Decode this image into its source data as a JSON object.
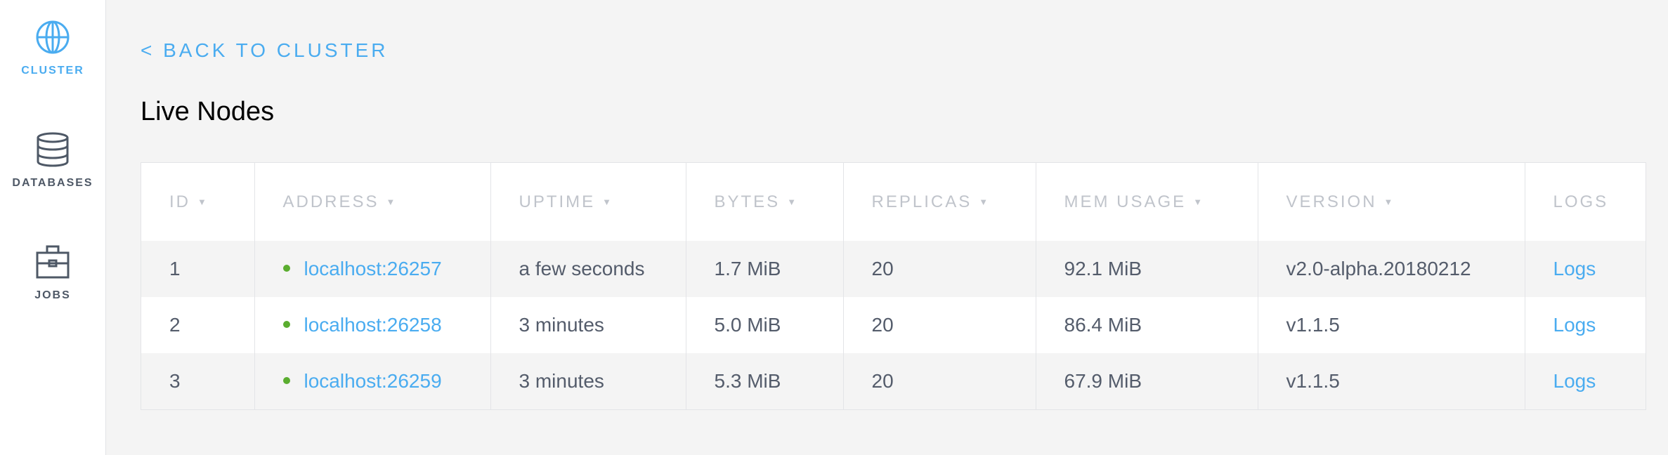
{
  "sidebar": {
    "items": [
      {
        "label": "CLUSTER",
        "icon": "globe-icon",
        "active": true
      },
      {
        "label": "DATABASES",
        "icon": "database-icon",
        "active": false
      },
      {
        "label": "JOBS",
        "icon": "briefcase-icon",
        "active": false
      }
    ]
  },
  "back_link": "< BACK TO CLUSTER",
  "page_title": "Live Nodes",
  "table": {
    "columns": [
      "ID",
      "ADDRESS",
      "UPTIME",
      "BYTES",
      "REPLICAS",
      "MEM USAGE",
      "VERSION",
      "LOGS"
    ],
    "sort_indicator": "▼",
    "rows": [
      {
        "id": "1",
        "address": "localhost:26257",
        "uptime": "a few seconds",
        "bytes": "1.7 MiB",
        "replicas": "20",
        "mem_usage": "92.1 MiB",
        "version": "v2.0-alpha.20180212",
        "logs": "Logs"
      },
      {
        "id": "2",
        "address": "localhost:26258",
        "uptime": "3 minutes",
        "bytes": "5.0 MiB",
        "replicas": "20",
        "mem_usage": "86.4 MiB",
        "version": "v1.1.5",
        "logs": "Logs"
      },
      {
        "id": "3",
        "address": "localhost:26259",
        "uptime": "3 minutes",
        "bytes": "5.3 MiB",
        "replicas": "20",
        "mem_usage": "67.9 MiB",
        "version": "v1.1.5",
        "logs": "Logs"
      }
    ]
  },
  "colors": {
    "accent": "#4aacf0",
    "status_live": "#5aad2f",
    "sidebar_text": "#4e5866",
    "page_bg": "#f4f4f4"
  }
}
